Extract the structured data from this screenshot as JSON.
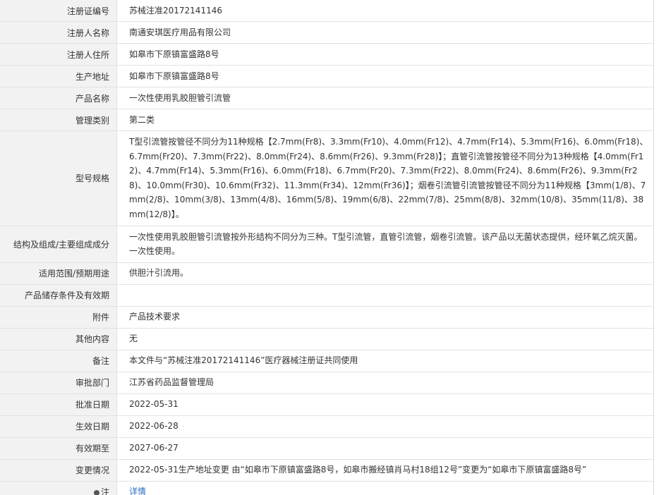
{
  "rows": [
    {
      "key": "reg_no",
      "label": "注册证编号",
      "value": "苏械注准20172141146"
    },
    {
      "key": "registrant",
      "label": "注册人名称",
      "value": "南通安琪医疗用品有限公司"
    },
    {
      "key": "registrant_address",
      "label": "注册人住所",
      "value": "如皋市下原镇富盛路8号"
    },
    {
      "key": "production_address",
      "label": "生产地址",
      "value": "如皋市下原镇富盛路8号"
    },
    {
      "key": "product_name",
      "label": "产品名称",
      "value": "一次性使用乳胶胆管引流管"
    },
    {
      "key": "category",
      "label": "管理类别",
      "value": "第二类"
    },
    {
      "key": "model_spec",
      "label": "型号规格",
      "value": "T型引流管按管径不同分为11种规格【2.7mm(Fr8)、3.3mm(Fr10)、4.0mm(Fr12)、4.7mm(Fr14)、5.3mm(Fr16)、6.0mm(Fr18)、6.7mm(Fr20)、7.3mm(Fr22)、8.0mm(Fr24)、8.6mm(Fr26)、9.3mm(Fr28)】；直管引流管按管径不同分为13种规格【4.0mm(Fr12)、4.7mm(Fr14)、5.3mm(Fr16)、6.0mm(Fr18)、6.7mm(Fr20)、7.3mm(Fr22)、8.0mm(Fr24)、8.6mm(Fr26)、9.3mm(Fr28)、10.0mm(Fr30)、10.6mm(Fr32)、11.3mm(Fr34)、12mm(Fr36)】；烟卷引流管引流管按管径不同分为11种规格【3mm(1/8)、7mm(2/8)、10mm(3/8)、13mm(4/8)、16mm(5/8)、19mm(6/8)、22mm(7/8)、25mm(8/8)、32mm(10/8)、35mm(11/8)、38mm(12/8)】。"
    },
    {
      "key": "structure",
      "label": "结构及组成/主要组成成分",
      "value": "一次性使用乳胶胆管引流管按外形结构不同分为三种。T型引流管，直管引流管，烟卷引流管。该产品以无菌状态提供，经环氧乙烷灭菌。一次性使用。"
    },
    {
      "key": "intended_use",
      "label": "适用范围/预期用途",
      "value": "供胆汁引流用。"
    },
    {
      "key": "storage",
      "label": "产品储存条件及有效期",
      "value": ""
    },
    {
      "key": "attachment",
      "label": "附件",
      "value": "产品技术要求"
    },
    {
      "key": "other",
      "label": "其他内容",
      "value": "无"
    },
    {
      "key": "remark",
      "label": "备注",
      "value": "本文件与“苏械注准20172141146”医疗器械注册证共同使用"
    },
    {
      "key": "approval_dept",
      "label": "审批部门",
      "value": "江苏省药品监督管理局"
    },
    {
      "key": "approval_date",
      "label": "批准日期",
      "value": "2022-05-31"
    },
    {
      "key": "effective_date",
      "label": "生效日期",
      "value": "2022-06-28"
    },
    {
      "key": "expiry_date",
      "label": "有效期至",
      "value": "2027-06-27"
    },
    {
      "key": "change",
      "label": "变更情况",
      "value": "2022-05-31生产地址变更 由“如皋市下原镇富盛路8号，如皋市搬经镇肖马村18组12号”变更为“如皋市下原镇富盛路8号”"
    }
  ],
  "note_row": {
    "label": "注",
    "link_text": "详情"
  }
}
